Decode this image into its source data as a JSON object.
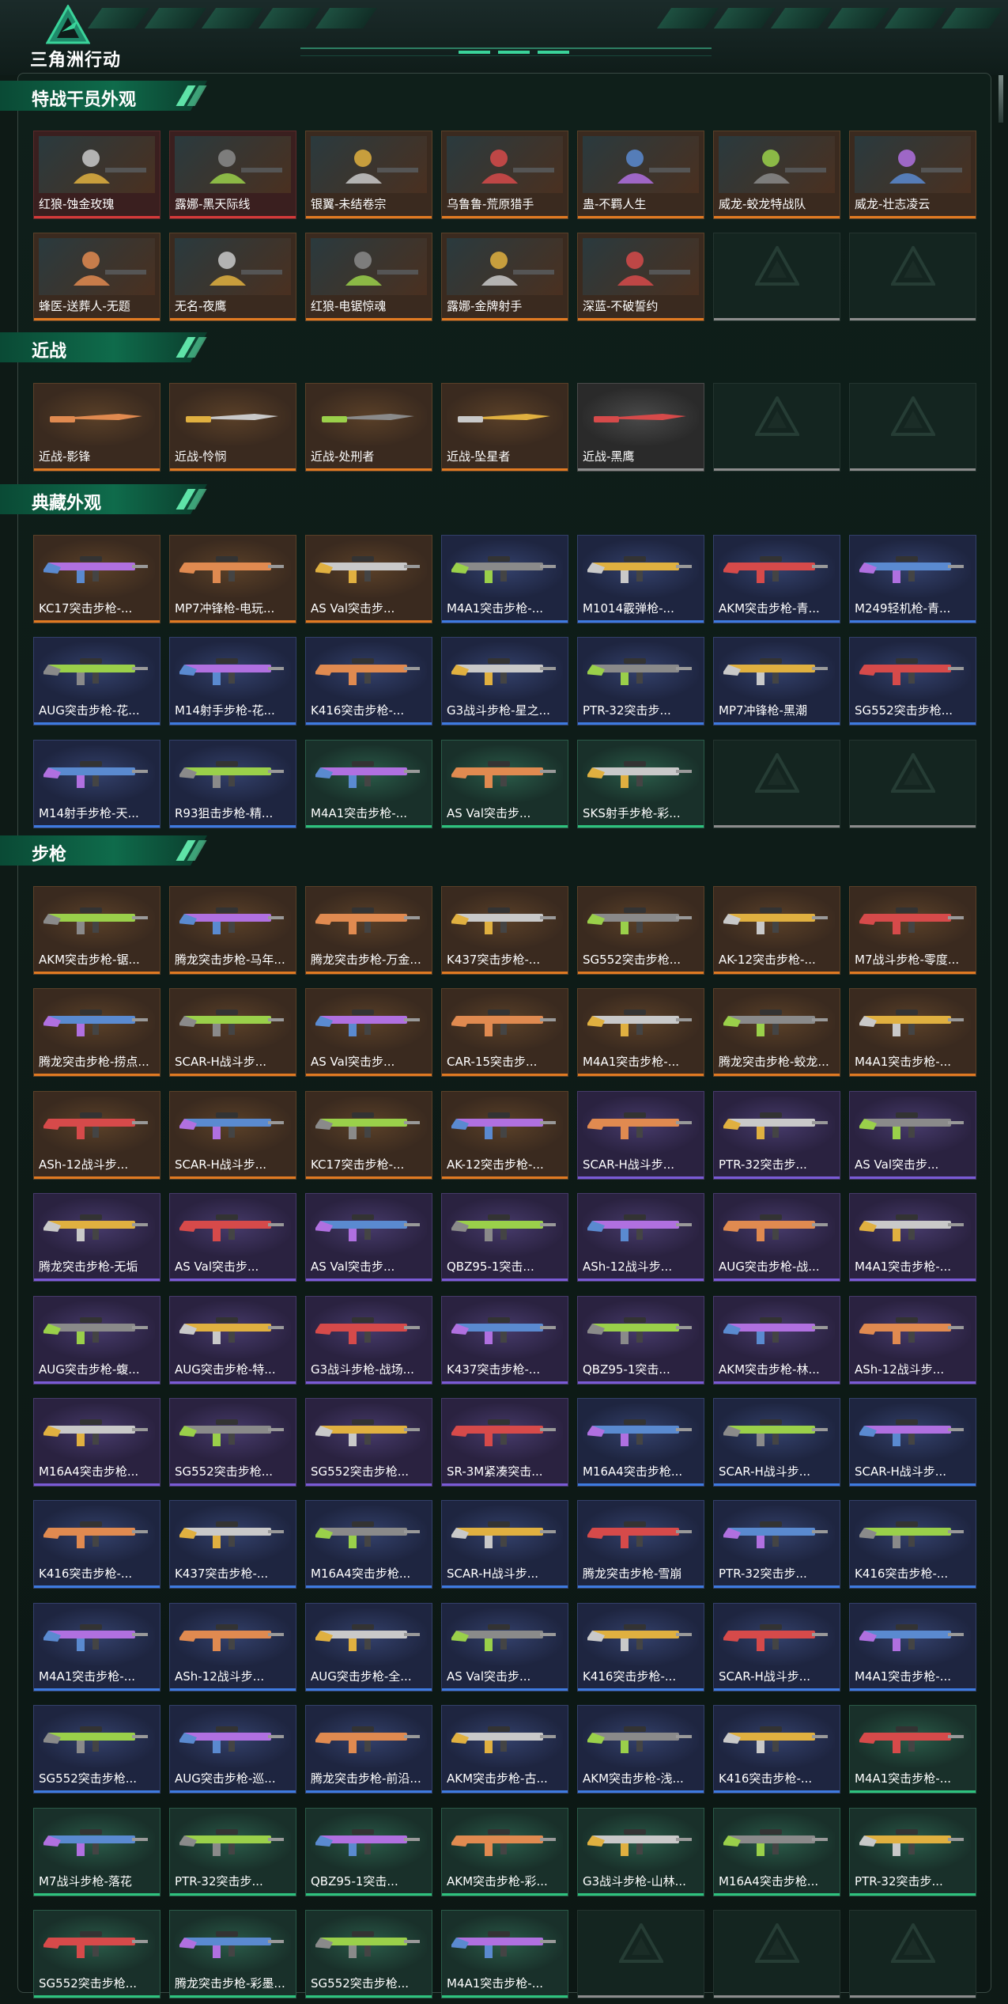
{
  "app": {
    "logo_text": "三角洲行动"
  },
  "colors": {
    "orange": "#e07a22",
    "purple": "#7a5bd6",
    "blue": "#3e7be0",
    "green": "#2ec27e",
    "red": "#d43a3a",
    "gray": "#8c8c8c",
    "accent": "#3ad39a"
  },
  "sections": [
    {
      "title": "特战干员外观",
      "kind": "operator",
      "items": [
        {
          "name": "红狼-蚀金玫瑰",
          "rarity": "red"
        },
        {
          "name": "露娜-黑天际线",
          "rarity": "red"
        },
        {
          "name": "银翼-未结卷宗",
          "rarity": "orange"
        },
        {
          "name": "乌鲁鲁-荒原猎手",
          "rarity": "orange"
        },
        {
          "name": "蛊-不羁人生",
          "rarity": "orange"
        },
        {
          "name": "威龙-蛟龙特战队",
          "rarity": "orange"
        },
        {
          "name": "威龙-壮志凌云",
          "rarity": "orange"
        },
        {
          "name": "蜂医-送葬人-无题",
          "rarity": "orange"
        },
        {
          "name": "无名-夜鹰",
          "rarity": "orange"
        },
        {
          "name": "红狼-电锯惊魂",
          "rarity": "orange"
        },
        {
          "name": "露娜-金牌射手",
          "rarity": "orange"
        },
        {
          "name": "深蓝-不破誓约",
          "rarity": "orange"
        },
        {
          "empty": true
        },
        {
          "empty": true
        }
      ]
    },
    {
      "title": "近战",
      "kind": "melee",
      "items": [
        {
          "name": "近战-影锋",
          "rarity": "orange"
        },
        {
          "name": "近战-怜悯",
          "rarity": "orange"
        },
        {
          "name": "近战-处刑者",
          "rarity": "orange"
        },
        {
          "name": "近战-坠星者",
          "rarity": "orange"
        },
        {
          "name": "近战-黑鹰",
          "rarity": "gray"
        },
        {
          "empty": true
        },
        {
          "empty": true
        }
      ]
    },
    {
      "title": "典藏外观",
      "kind": "weapon",
      "items": [
        {
          "name": "KC17突击步枪-...",
          "rarity": "orange"
        },
        {
          "name": "MP7冲锋枪-电玩...",
          "rarity": "orange"
        },
        {
          "name": "AS Val突击步...",
          "rarity": "orange"
        },
        {
          "name": "M4A1突击步枪-...",
          "rarity": "blue"
        },
        {
          "name": "M1014霰弹枪-...",
          "rarity": "blue"
        },
        {
          "name": "AKM突击步枪-青...",
          "rarity": "blue"
        },
        {
          "name": "M249轻机枪-青...",
          "rarity": "blue"
        },
        {
          "name": "AUG突击步枪-花...",
          "rarity": "blue"
        },
        {
          "name": "M14射手步枪-花...",
          "rarity": "blue"
        },
        {
          "name": "K416突击步枪-...",
          "rarity": "blue"
        },
        {
          "name": "G3战斗步枪-星之...",
          "rarity": "blue"
        },
        {
          "name": "PTR-32突击步...",
          "rarity": "blue"
        },
        {
          "name": "MP7冲锋枪-黑潮",
          "rarity": "blue"
        },
        {
          "name": "SG552突击步枪...",
          "rarity": "blue"
        },
        {
          "name": "M14射手步枪-天...",
          "rarity": "blue"
        },
        {
          "name": "R93狙击步枪-精...",
          "rarity": "blue"
        },
        {
          "name": "M4A1突击步枪-...",
          "rarity": "green"
        },
        {
          "name": "AS Val突击步...",
          "rarity": "green"
        },
        {
          "name": "SKS射手步枪-彩...",
          "rarity": "green"
        },
        {
          "empty": true
        },
        {
          "empty": true
        }
      ]
    },
    {
      "title": "步枪",
      "kind": "weapon",
      "items": [
        {
          "name": "AKM突击步枪-锯...",
          "rarity": "orange"
        },
        {
          "name": "腾龙突击步枪-马年...",
          "rarity": "orange"
        },
        {
          "name": "腾龙突击步枪-万金...",
          "rarity": "orange"
        },
        {
          "name": "K437突击步枪-...",
          "rarity": "orange"
        },
        {
          "name": "SG552突击步枪...",
          "rarity": "orange"
        },
        {
          "name": "AK-12突击步枪-...",
          "rarity": "orange"
        },
        {
          "name": "M7战斗步枪-零度...",
          "rarity": "orange"
        },
        {
          "name": "腾龙突击步枪-捞点...",
          "rarity": "orange"
        },
        {
          "name": "SCAR-H战斗步...",
          "rarity": "orange"
        },
        {
          "name": "AS Val突击步...",
          "rarity": "orange"
        },
        {
          "name": "CAR-15突击步...",
          "rarity": "orange"
        },
        {
          "name": "M4A1突击步枪-...",
          "rarity": "orange"
        },
        {
          "name": "腾龙突击步枪-蛟龙...",
          "rarity": "orange"
        },
        {
          "name": "M4A1突击步枪-...",
          "rarity": "orange"
        },
        {
          "name": "ASh-12战斗步...",
          "rarity": "orange"
        },
        {
          "name": "SCAR-H战斗步...",
          "rarity": "orange"
        },
        {
          "name": "KC17突击步枪-...",
          "rarity": "orange"
        },
        {
          "name": "AK-12突击步枪-...",
          "rarity": "orange"
        },
        {
          "name": "SCAR-H战斗步...",
          "rarity": "purple"
        },
        {
          "name": "PTR-32突击步...",
          "rarity": "purple"
        },
        {
          "name": "AS Val突击步...",
          "rarity": "purple"
        },
        {
          "name": "腾龙突击步枪-无垢",
          "rarity": "purple"
        },
        {
          "name": "AS Val突击步...",
          "rarity": "purple"
        },
        {
          "name": "AS Val突击步...",
          "rarity": "purple"
        },
        {
          "name": "QBZ95-1突击...",
          "rarity": "purple"
        },
        {
          "name": "ASh-12战斗步...",
          "rarity": "purple"
        },
        {
          "name": "AUG突击步枪-战...",
          "rarity": "purple"
        },
        {
          "name": "M4A1突击步枪-...",
          "rarity": "purple"
        },
        {
          "name": "AUG突击步枪-蝮...",
          "rarity": "purple"
        },
        {
          "name": "AUG突击步枪-特...",
          "rarity": "purple"
        },
        {
          "name": "G3战斗步枪-战场...",
          "rarity": "purple"
        },
        {
          "name": "K437突击步枪-...",
          "rarity": "purple"
        },
        {
          "name": "QBZ95-1突击...",
          "rarity": "purple"
        },
        {
          "name": "AKM突击步枪-林...",
          "rarity": "purple"
        },
        {
          "name": "ASh-12战斗步...",
          "rarity": "purple"
        },
        {
          "name": "M16A4突击步枪...",
          "rarity": "purple"
        },
        {
          "name": "SG552突击步枪...",
          "rarity": "purple"
        },
        {
          "name": "SG552突击步枪...",
          "rarity": "purple"
        },
        {
          "name": "SR-3M紧凑突击...",
          "rarity": "purple"
        },
        {
          "name": "M16A4突击步枪...",
          "rarity": "blue"
        },
        {
          "name": "SCAR-H战斗步...",
          "rarity": "blue"
        },
        {
          "name": "SCAR-H战斗步...",
          "rarity": "blue"
        },
        {
          "name": "K416突击步枪-...",
          "rarity": "blue"
        },
        {
          "name": "K437突击步枪-...",
          "rarity": "blue"
        },
        {
          "name": "M16A4突击步枪...",
          "rarity": "blue"
        },
        {
          "name": "SCAR-H战斗步...",
          "rarity": "blue"
        },
        {
          "name": "腾龙突击步枪-雪崩",
          "rarity": "blue"
        },
        {
          "name": "PTR-32突击步...",
          "rarity": "blue"
        },
        {
          "name": "K416突击步枪-...",
          "rarity": "blue"
        },
        {
          "name": "M4A1突击步枪-...",
          "rarity": "blue"
        },
        {
          "name": "ASh-12战斗步...",
          "rarity": "blue"
        },
        {
          "name": "AUG突击步枪-全...",
          "rarity": "blue"
        },
        {
          "name": "AS Val突击步...",
          "rarity": "blue"
        },
        {
          "name": "K416突击步枪-...",
          "rarity": "blue"
        },
        {
          "name": "SCAR-H战斗步...",
          "rarity": "blue"
        },
        {
          "name": "M4A1突击步枪-...",
          "rarity": "blue"
        },
        {
          "name": "SG552突击步枪...",
          "rarity": "blue"
        },
        {
          "name": "AUG突击步枪-巡...",
          "rarity": "blue"
        },
        {
          "name": "腾龙突击步枪-前沿...",
          "rarity": "blue"
        },
        {
          "name": "AKM突击步枪-古...",
          "rarity": "blue"
        },
        {
          "name": "AKM突击步枪-浅...",
          "rarity": "blue"
        },
        {
          "name": "K416突击步枪-...",
          "rarity": "blue"
        },
        {
          "name": "M4A1突击步枪-...",
          "rarity": "green"
        },
        {
          "name": "M7战斗步枪-落花",
          "rarity": "green"
        },
        {
          "name": "PTR-32突击步...",
          "rarity": "green"
        },
        {
          "name": "QBZ95-1突击...",
          "rarity": "green"
        },
        {
          "name": "AKM突击步枪-彩...",
          "rarity": "green"
        },
        {
          "name": "G3战斗步枪-山林...",
          "rarity": "green"
        },
        {
          "name": "M16A4突击步枪...",
          "rarity": "green"
        },
        {
          "name": "PTR-32突击步...",
          "rarity": "green"
        },
        {
          "name": "SG552突击步枪...",
          "rarity": "green"
        },
        {
          "name": "腾龙突击步枪-彩墨...",
          "rarity": "green"
        },
        {
          "name": "SG552突击步枪...",
          "rarity": "green"
        },
        {
          "name": "M4A1突击步枪-...",
          "rarity": "green"
        },
        {
          "empty": true
        },
        {
          "empty": true
        },
        {
          "empty": true
        }
      ]
    }
  ]
}
